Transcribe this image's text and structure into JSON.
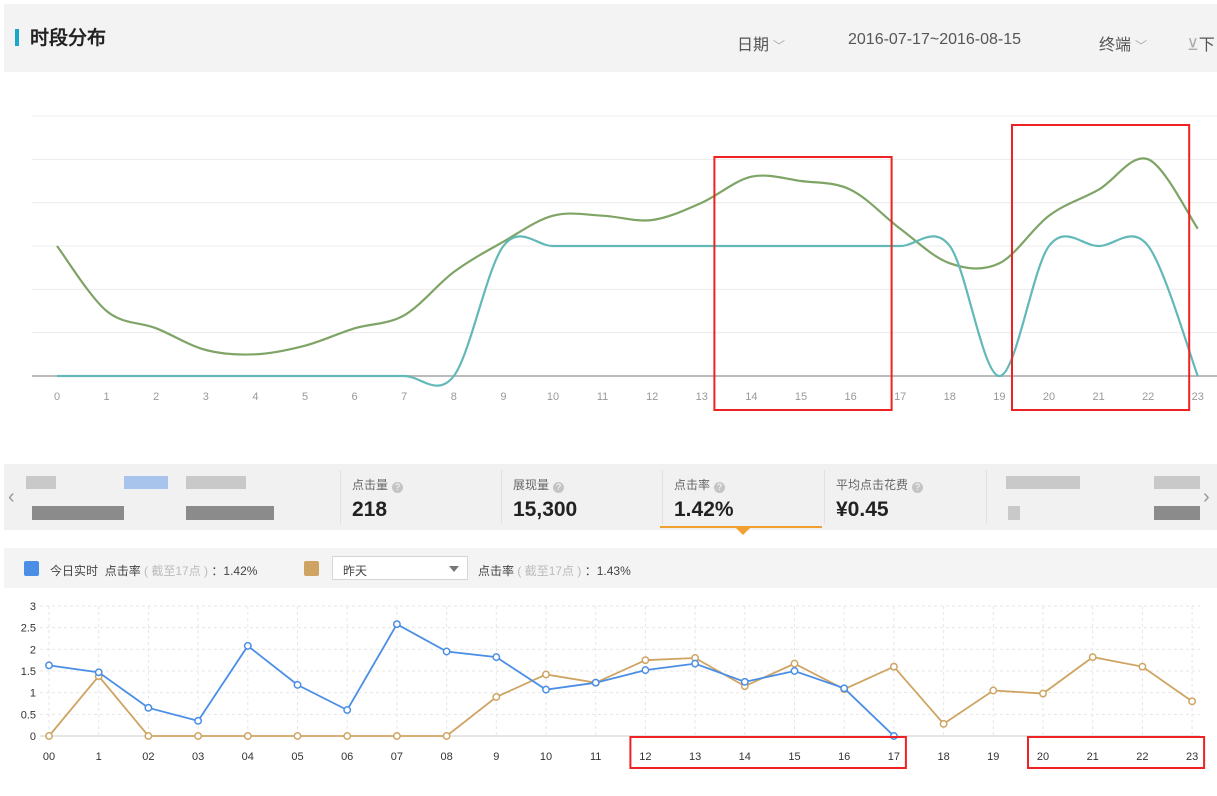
{
  "header": {
    "title": "时段分布",
    "date_dropdown": "日期",
    "date_range": "2016-07-17~2016-08-15",
    "terminal_dropdown": "终端",
    "download_label": "下"
  },
  "stats": [
    {
      "label": "点击量",
      "value": "218"
    },
    {
      "label": "展现量",
      "value": "15,300"
    },
    {
      "label": "点击率",
      "value": "1.42%",
      "active": true
    },
    {
      "label": "平均点击花费",
      "value": "¥0.45"
    }
  ],
  "legend": {
    "today_label": "今日实时",
    "today_metric": "点击率",
    "today_note": "( 截至17点 )",
    "today_value": "：1.42%",
    "compare_option": "昨天",
    "compare_metric": "点击率",
    "compare_note": "( 截至17点 )",
    "compare_value": "：1.43%"
  },
  "colors": {
    "accent": "#18a8c8",
    "top_green": "#7ea466",
    "top_teal": "#63b8b8",
    "today_blue": "#4a8ee6",
    "yesterday_tan": "#cfa462",
    "highlight_red": "#ee2222"
  },
  "chart_data": [
    {
      "type": "line",
      "categories": [
        "0",
        "1",
        "2",
        "3",
        "4",
        "5",
        "6",
        "7",
        "8",
        "9",
        "10",
        "11",
        "12",
        "13",
        "14",
        "15",
        "16",
        "17",
        "18",
        "19",
        "20",
        "21",
        "22",
        "23"
      ],
      "ylim": [
        0,
        6
      ],
      "grid": true,
      "series": [
        {
          "values": [
            3.0,
            1.5,
            1.1,
            0.6,
            0.5,
            0.7,
            1.1,
            1.4,
            2.4,
            3.1,
            3.7,
            3.7,
            3.6,
            4.0,
            4.6,
            4.5,
            4.3,
            3.4,
            2.6,
            2.6,
            3.7,
            4.3,
            5.0,
            3.4
          ],
          "color": "#7ea466"
        },
        {
          "values": [
            0,
            0,
            0,
            0,
            0,
            0,
            0,
            0,
            0,
            3,
            3,
            3,
            3,
            3,
            3,
            3,
            3,
            3,
            3,
            0,
            3,
            3,
            3,
            0
          ],
          "color": "#63b8b8"
        }
      ],
      "highlights": [
        [
          14,
          16
        ],
        [
          20,
          22
        ]
      ]
    },
    {
      "type": "line",
      "categories": [
        "00",
        "1",
        "02",
        "03",
        "04",
        "05",
        "06",
        "07",
        "08",
        "9",
        "10",
        "11",
        "12",
        "13",
        "14",
        "15",
        "16",
        "17",
        "18",
        "19",
        "20",
        "21",
        "22",
        "23"
      ],
      "yticks": [
        "0",
        "0.5",
        "1",
        "1.5",
        "2",
        "2.5",
        "3"
      ],
      "ylim": [
        0,
        3
      ],
      "grid": true,
      "series": [
        {
          "name": "今日实时",
          "values": [
            1.63,
            1.47,
            0.65,
            0.35,
            2.08,
            1.18,
            0.6,
            2.58,
            1.95,
            1.82,
            1.07,
            1.23,
            1.52,
            1.67,
            1.25,
            1.5,
            1.1,
            0.0
          ],
          "color": "#4a8ee6"
        },
        {
          "name": "昨天",
          "values": [
            0.0,
            1.38,
            0.0,
            0.0,
            0.0,
            0.0,
            0.0,
            0.0,
            0.0,
            0.9,
            1.42,
            1.23,
            1.75,
            1.8,
            1.15,
            1.67,
            1.08,
            1.6,
            0.28,
            1.05,
            0.98,
            1.82,
            1.6,
            0.8
          ],
          "color": "#cfa462"
        }
      ],
      "highlights": [
        [
          12,
          17
        ],
        [
          20,
          23
        ]
      ]
    }
  ]
}
